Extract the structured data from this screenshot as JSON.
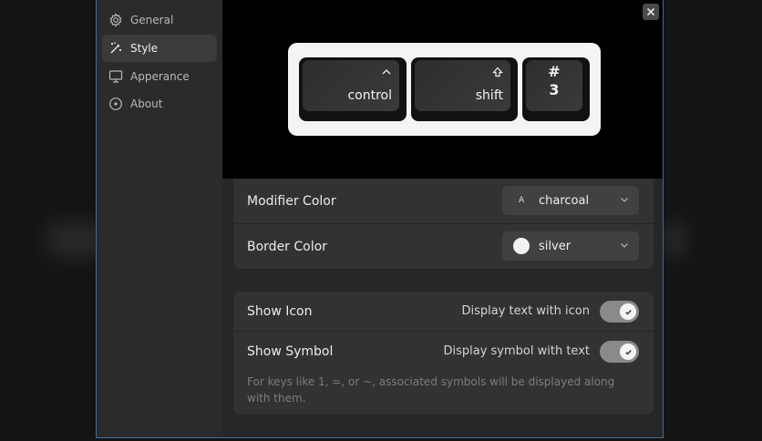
{
  "sidebar": {
    "items": [
      {
        "label": "General",
        "icon": "gear-icon"
      },
      {
        "label": "Style",
        "icon": "magic-wand-icon"
      },
      {
        "label": "Apperance",
        "icon": "monitor-icon"
      },
      {
        "label": "About",
        "icon": "info-circle-icon"
      }
    ],
    "active": "Style"
  },
  "preview": {
    "keys": [
      {
        "name": "control",
        "glyph": "^"
      },
      {
        "name": "shift",
        "glyph": "shift-arrow-icon"
      },
      {
        "symbol": "#",
        "number": "3"
      }
    ]
  },
  "colors": {
    "modifier": {
      "label": "Modifier Color",
      "value": "charcoal",
      "swatch_letter": "A"
    },
    "border": {
      "label": "Border Color",
      "value": "silver"
    }
  },
  "toggles": {
    "show_icon": {
      "label": "Show Icon",
      "hint": "Display text with icon",
      "on": true
    },
    "show_symbol": {
      "label": "Show Symbol",
      "hint": "Display symbol with text",
      "on": true
    },
    "note": "For keys like 1, =, or ~, associated symbols will be displayed along with them."
  },
  "theme": {
    "accent_border": "#3d6f9a",
    "panel": "#323232",
    "toggle_on": "#8a8a8a"
  }
}
